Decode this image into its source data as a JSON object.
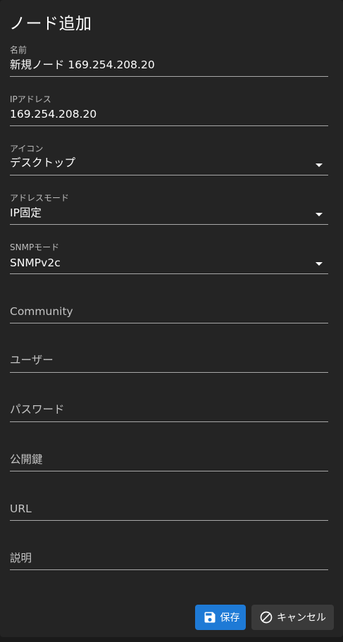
{
  "dialog": {
    "title": "ノード追加"
  },
  "fields": {
    "name": {
      "label": "名前",
      "value": "新規ノード 169.254.208.20"
    },
    "ip": {
      "label": "IPアドレス",
      "value": "169.254.208.20"
    },
    "icon": {
      "label": "アイコン",
      "value": "デスクトップ"
    },
    "address_mode": {
      "label": "アドレスモード",
      "value": "IP固定"
    },
    "snmp_mode": {
      "label": "SNMPモード",
      "value": "SNMPv2c"
    },
    "community": {
      "placeholder": "Community"
    },
    "user": {
      "placeholder": "ユーザー"
    },
    "password": {
      "placeholder": "パスワード"
    },
    "public_key": {
      "placeholder": "公開鍵"
    },
    "url": {
      "placeholder": "URL"
    },
    "description": {
      "placeholder": "説明"
    }
  },
  "actions": {
    "save_label": "保存",
    "save_icon": "floppy-disk-icon",
    "cancel_label": "キャンセル",
    "cancel_icon": "cancel-circle-icon"
  },
  "colors": {
    "background": "#242424",
    "primary": "#1e7ad6",
    "secondary_button": "#3a3a3a"
  }
}
